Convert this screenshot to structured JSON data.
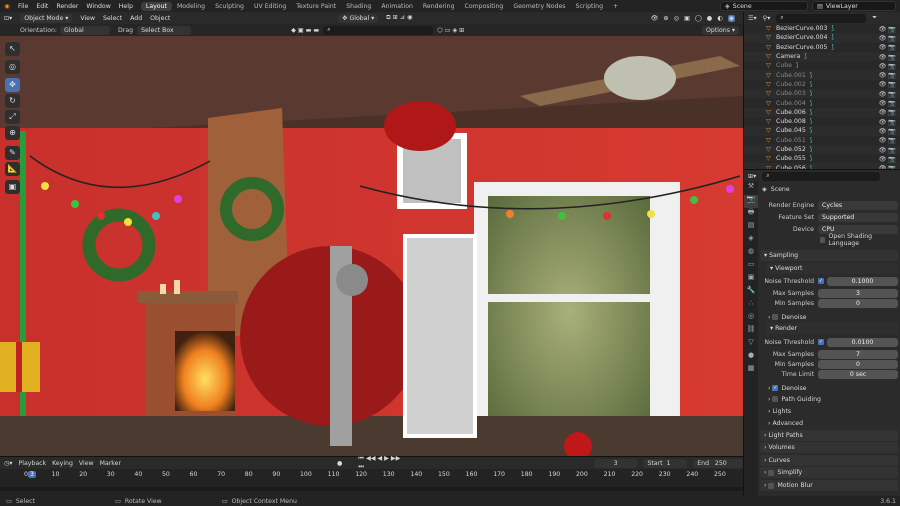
{
  "menu": [
    "File",
    "Edit",
    "Render",
    "Window",
    "Help"
  ],
  "tabs": [
    {
      "label": "Layout",
      "active": true
    },
    {
      "label": "Modeling"
    },
    {
      "label": "Sculpting"
    },
    {
      "label": "UV Editing"
    },
    {
      "label": "Texture Paint"
    },
    {
      "label": "Shading"
    },
    {
      "label": "Animation"
    },
    {
      "label": "Rendering"
    },
    {
      "label": "Compositing"
    },
    {
      "label": "Geometry Nodes"
    },
    {
      "label": "Scripting"
    },
    {
      "label": "+"
    }
  ],
  "scene": "Scene",
  "view_layer": "ViewLayer",
  "header": {
    "mode": "Object Mode",
    "view": "View",
    "select": "Select",
    "add": "Add",
    "object": "Object",
    "transform": "Global"
  },
  "header2": {
    "orientation_label": "Orientation:",
    "orientation": "Global",
    "drag_label": "Drag",
    "drag": "Select Box",
    "options": "Options"
  },
  "outliner": [
    {
      "name": "BezierCurve.003",
      "dim": false
    },
    {
      "name": "BezierCurve.004",
      "dim": false
    },
    {
      "name": "BezierCurve.005",
      "dim": false
    },
    {
      "name": "Camera",
      "dim": false
    },
    {
      "name": "Cube",
      "dim": true
    },
    {
      "name": "Cube.001",
      "dim": true
    },
    {
      "name": "Cube.002",
      "dim": true
    },
    {
      "name": "Cube.003",
      "dim": true
    },
    {
      "name": "Cube.004",
      "dim": true
    },
    {
      "name": "Cube.006",
      "dim": false
    },
    {
      "name": "Cube.008",
      "dim": false
    },
    {
      "name": "Cube.045",
      "dim": false
    },
    {
      "name": "Cube.051",
      "dim": true
    },
    {
      "name": "Cube.052",
      "dim": false
    },
    {
      "name": "Cube.055",
      "dim": false
    },
    {
      "name": "Cube.056",
      "dim": false
    }
  ],
  "props": {
    "scene": "Scene",
    "render_engine_label": "Render Engine",
    "render_engine": "Cycles",
    "feature_set_label": "Feature Set",
    "feature_set": "Supported",
    "device_label": "Device",
    "device": "CPU",
    "osl": "Open Shading Language",
    "sampling": "Sampling",
    "viewport": "Viewport",
    "noise_threshold_label": "Noise Threshold",
    "viewport_noise": "0.1000",
    "max_samples_label": "Max Samples",
    "viewport_max": "3",
    "min_samples_label": "Min Samples",
    "viewport_min": "0",
    "denoise": "Denoise",
    "render": "Render",
    "render_noise": "0.0100",
    "render_max": "7",
    "render_min": "0",
    "time_limit_label": "Time Limit",
    "time_limit": "0 sec",
    "render_denoise": "Denoise",
    "path_guiding": "Path Guiding",
    "lights": "Lights",
    "advanced": "Advanced",
    "light_paths": "Light Paths",
    "volumes": "Volumes",
    "curves": "Curves",
    "simplify": "Simplify",
    "motion_blur": "Motion Blur"
  },
  "timeline": {
    "playback": "Playback",
    "keying": "Keying",
    "view": "View",
    "marker": "Marker",
    "current_frame": "3",
    "start_label": "Start",
    "start": "1",
    "end_label": "End",
    "end": "250",
    "ticks": [
      "0",
      "10",
      "20",
      "30",
      "40",
      "50",
      "60",
      "70",
      "80",
      "90",
      "100",
      "110",
      "120",
      "130",
      "140",
      "150",
      "160",
      "170",
      "180",
      "190",
      "200",
      "210",
      "220",
      "230",
      "240",
      "250"
    ]
  },
  "status": {
    "select": "Select",
    "rotate": "Rotate View",
    "context": "Object Context Menu",
    "version": "3.6.1"
  }
}
